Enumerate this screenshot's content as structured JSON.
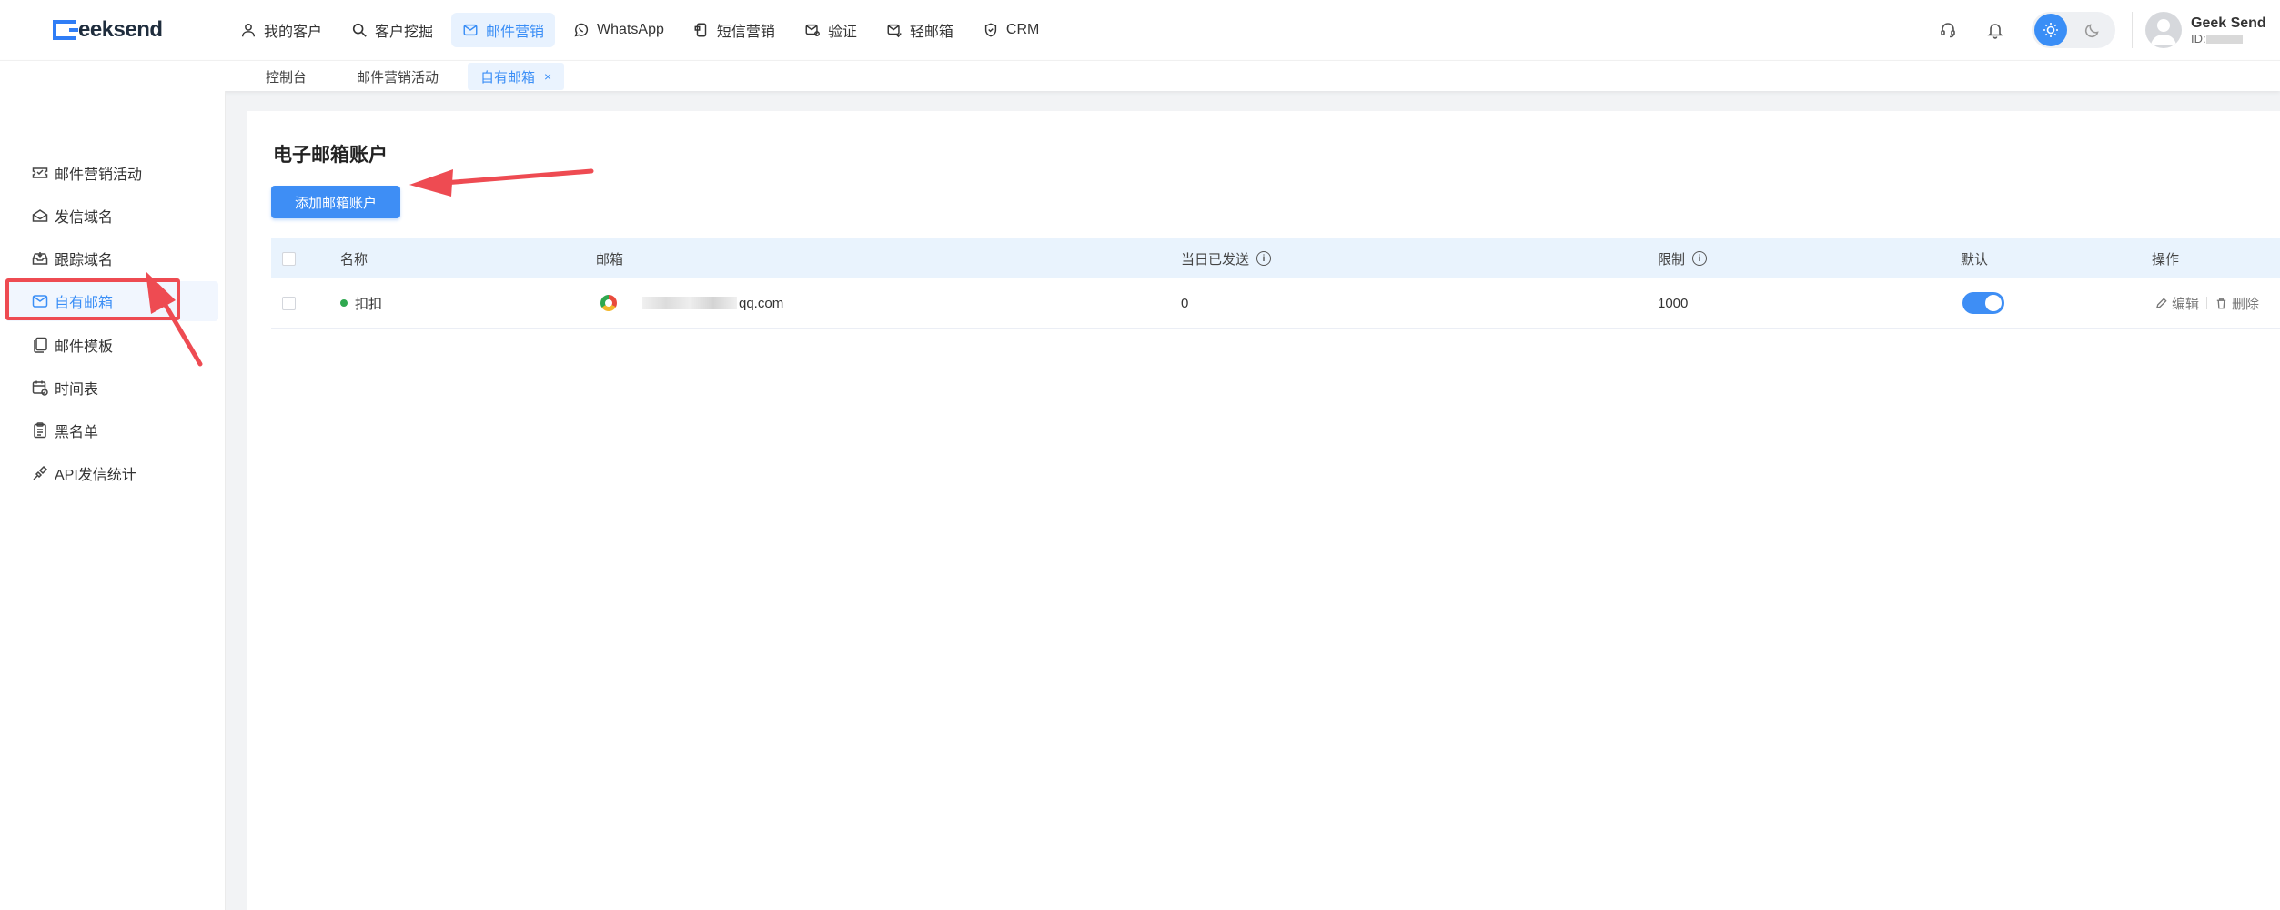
{
  "brand": {
    "logo_text": "eeksend",
    "accent": "#3a8ef6",
    "primary_button": "#3e8ef5",
    "annotation": "#ee4b52"
  },
  "nav": [
    {
      "label": "我的客户",
      "icon": "user-icon"
    },
    {
      "label": "客户挖掘",
      "icon": "search-icon"
    },
    {
      "label": "邮件营销",
      "icon": "mail-icon",
      "active": true
    },
    {
      "label": "WhatsApp",
      "icon": "whatsapp-icon"
    },
    {
      "label": "短信营销",
      "icon": "sms-icon"
    },
    {
      "label": "验证",
      "icon": "verify-mail-icon"
    },
    {
      "label": "轻邮箱",
      "icon": "light-mail-icon"
    },
    {
      "label": "CRM",
      "icon": "crm-shield-icon"
    }
  ],
  "header": {
    "support_icon": "headset-icon",
    "notification_icon": "bell-icon",
    "theme": {
      "light_icon": "sun-icon",
      "dark_icon": "moon-icon",
      "selected": "light"
    },
    "user": {
      "name": "Geek Send",
      "id_label": "ID:"
    }
  },
  "tabs": [
    {
      "label": "控制台"
    },
    {
      "label": "邮件营销活动"
    },
    {
      "label": "自有邮箱",
      "active": true,
      "close": "×"
    }
  ],
  "sidebar": {
    "items": [
      {
        "label": "邮件营销活动",
        "icon": "ticket-icon"
      },
      {
        "label": "发信域名",
        "icon": "domain-icon"
      },
      {
        "label": "跟踪域名",
        "icon": "inbox-icon"
      },
      {
        "label": "自有邮箱",
        "icon": "mail-icon",
        "active": true
      },
      {
        "label": "邮件模板",
        "icon": "template-icon"
      },
      {
        "label": "时间表",
        "icon": "calendar-icon"
      },
      {
        "label": "黑名单",
        "icon": "clipboard-icon"
      },
      {
        "label": "API发信统计",
        "icon": "api-icon"
      }
    ]
  },
  "main": {
    "title": "电子邮箱账户",
    "add_button": "添加邮箱账户",
    "table": {
      "headers": {
        "name": "名称",
        "email": "邮箱",
        "sent_today": "当日已发送",
        "limit": "限制",
        "default": "默认",
        "actions": "操作"
      },
      "info_glyph": "i",
      "rows": [
        {
          "name": "扣扣",
          "status": "active",
          "email_suffix": "qq.com",
          "sent_today": "0",
          "limit": "1000",
          "default": true,
          "edit": "编辑",
          "delete": "删除"
        }
      ]
    }
  }
}
